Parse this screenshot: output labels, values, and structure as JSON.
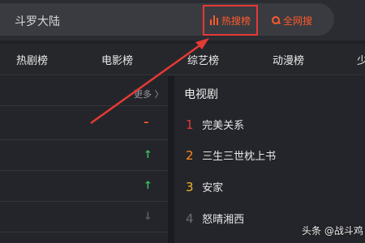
{
  "search": {
    "query": "斗罗大陆"
  },
  "header": {
    "hot_label": "热搜榜",
    "all_label": "全网搜"
  },
  "tabs": [
    "热剧榜",
    "电影榜",
    "综艺榜",
    "动漫榜",
    "少"
  ],
  "left_list": {
    "more_label": "更多 〉",
    "trends": [
      "–",
      "↑",
      "↑",
      "↓"
    ]
  },
  "right_list": {
    "title": "电视剧",
    "items": [
      {
        "rank": "1",
        "title": "完美关系",
        "color": "#e53935"
      },
      {
        "rank": "2",
        "title": "三生三世枕上书",
        "color": "#ff8a1f"
      },
      {
        "rank": "3",
        "title": "安家",
        "color": "#f2b42a"
      },
      {
        "rank": "4",
        "title": "怒晴湘西",
        "color": "#6b6c71"
      }
    ]
  },
  "watermark": "头条 @战斗鸡",
  "colors": {
    "accent": "#ff5a2a",
    "highlight_box": "#e53935",
    "up": "#3bbf5b",
    "background": "#202125"
  }
}
